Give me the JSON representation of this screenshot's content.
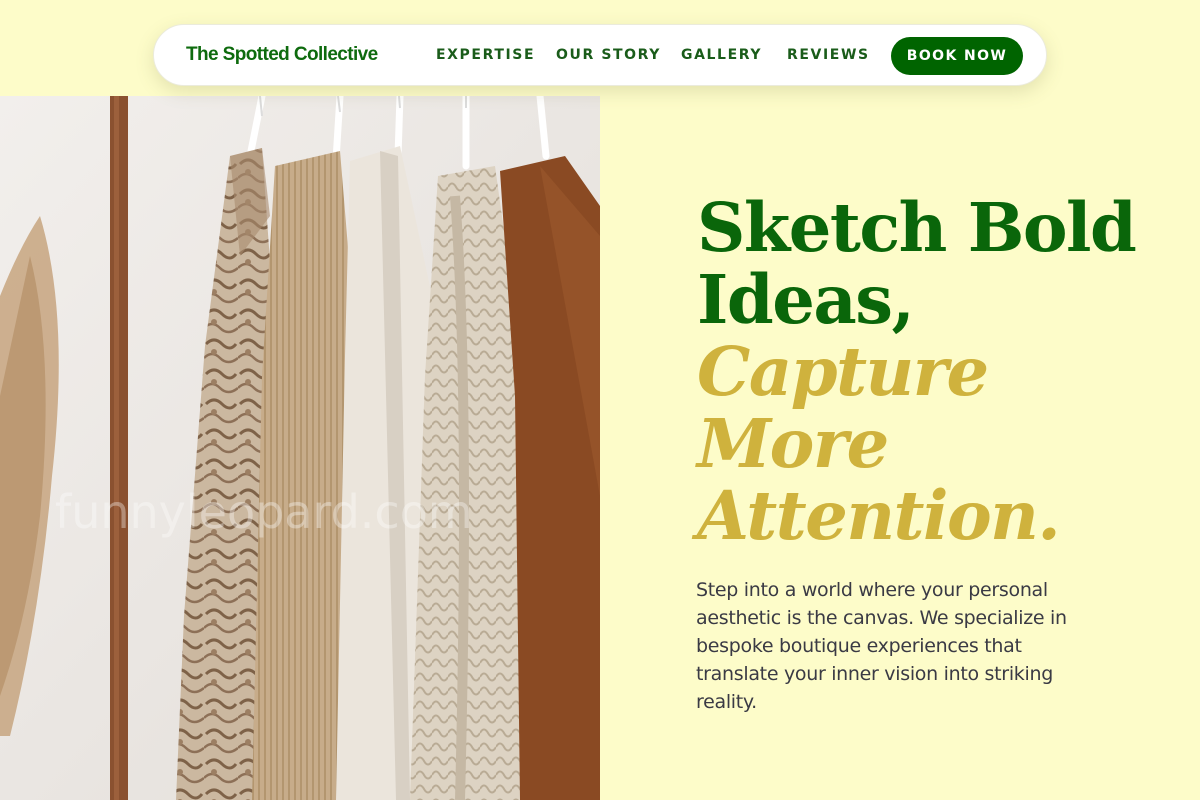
{
  "nav": {
    "brand": "The Spotted Collective",
    "links": [
      "EXPERTISE",
      "OUR STORY",
      "GALLERY",
      "REVIEWS"
    ],
    "cta": "BOOK NOW"
  },
  "hero": {
    "headline_lines": [
      "Sketch Bold",
      "Ideas,"
    ],
    "accent_lines": [
      "Capture",
      "More",
      "Attention."
    ],
    "body": "Step into a world where your personal aesthetic is the canvas. We specialize in bespoke boutique experiences that translate your inner vision into striking reality.",
    "image_watermark": "funnyleopard.com"
  },
  "colors": {
    "background": "#fdfcc9",
    "primary_green": "#006400",
    "accent_gold": "#cfb23d",
    "body_text": "#3a3a44"
  }
}
